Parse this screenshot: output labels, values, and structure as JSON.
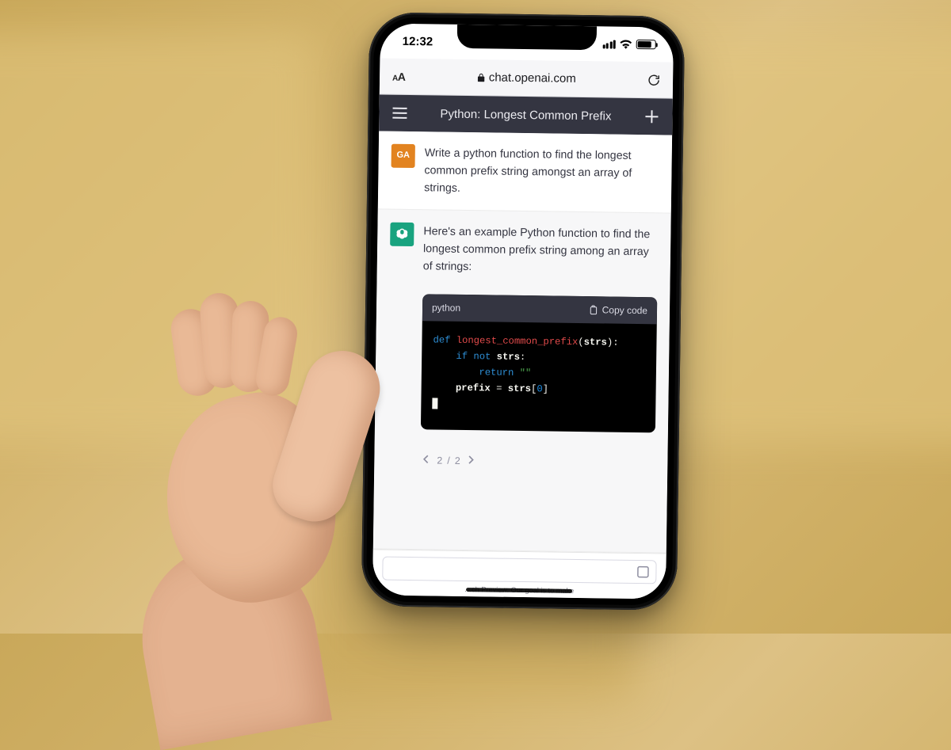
{
  "status_bar": {
    "time": "12:32"
  },
  "safari": {
    "aa_label_small": "A",
    "aa_label_big": "A",
    "url": "chat.openai.com"
  },
  "chat_header": {
    "title": "Python: Longest Common Prefix"
  },
  "conversation": {
    "user": {
      "avatar_initials": "GA",
      "text": "Write a python function to find the longest common prefix string amongst an array of strings."
    },
    "assistant": {
      "text": "Here's an example Python function to find the longest common prefix string among an array of strings:",
      "code": {
        "language": "python",
        "copy_label": "Copy code",
        "lines": {
          "kw_def": "def",
          "fn_name": "longest_common_prefix",
          "param": "strs",
          "kw_if": "if",
          "kw_not": "not",
          "id_strs": "strs",
          "kw_return": "return",
          "str_empty": "\"\"",
          "id_prefix": "prefix",
          "eq": "=",
          "strs2": "strs",
          "idx0": "0"
        }
      }
    },
    "pagination": {
      "current": "2",
      "total": "2",
      "sep": "/"
    }
  },
  "footer": {
    "hint": "…ch Preview. Our goal is to make"
  }
}
